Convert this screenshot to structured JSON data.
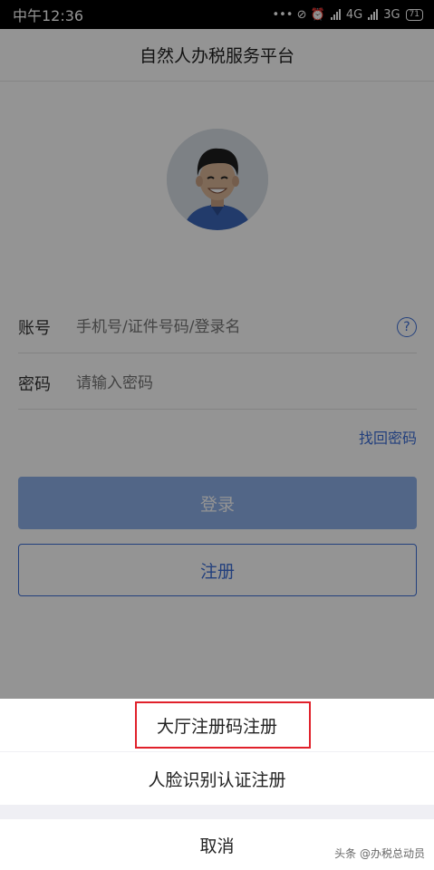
{
  "status_bar": {
    "time": "中午12:36",
    "icons": "••• ⊘ ⏰",
    "net1": "4G",
    "net2": "3G",
    "battery": "71"
  },
  "header": {
    "title": "自然人办税服务平台"
  },
  "avatar": {
    "icon": "user-avatar-cartoon-man"
  },
  "form": {
    "account_label": "账号",
    "account_placeholder": "手机号/证件号码/登录名",
    "help_icon": "?",
    "password_label": "密码",
    "password_placeholder": "请输入密码",
    "forgot_password": "找回密码",
    "login_button": "登录",
    "register_button": "注册"
  },
  "action_sheet": {
    "option_hall_code": "大厅注册码注册",
    "option_face_auth": "人脸识别认证注册",
    "cancel": "取消"
  },
  "colors": {
    "accent": "#3d6fd8",
    "login_disabled": "#8eb0e8",
    "highlight": "#e0212b"
  },
  "watermark": "头条 @办税总动员"
}
